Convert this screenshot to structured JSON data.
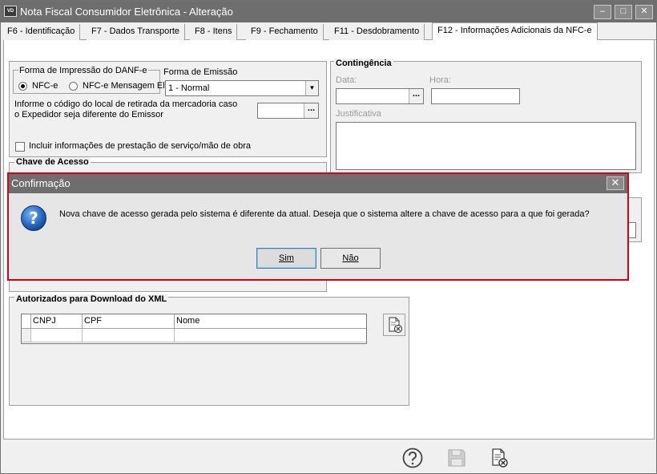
{
  "window": {
    "icon_text": "VD",
    "title": "Nota Fiscal Consumidor Eletrônica - Alteração",
    "minimize": "–",
    "maximize": "□",
    "close": "✕"
  },
  "tabs": [
    {
      "label": "F6 - Identificação"
    },
    {
      "label": "F7 - Dados Transporte"
    },
    {
      "label": "F8 - Itens"
    },
    {
      "label": "F9 - Fechamento"
    },
    {
      "label": "F11 - Desdobramento"
    },
    {
      "label": "F12 - Informações Adicionais da NFC-e"
    }
  ],
  "danfe": {
    "group_label": "Forma de Impressão do DANF-e",
    "option1": "NFC-e",
    "option2": "NFC-e Mensagem El",
    "selected": "NFC-e"
  },
  "emissao": {
    "label": "Forma de Emissão",
    "value": "1 - Normal",
    "arrow": "▼"
  },
  "retirada": {
    "line1": "Informe o código do local de retirada da mercadoria caso",
    "line2": "o Expedidor seja diferente do Emissor",
    "button": "..."
  },
  "servico": {
    "label": "Incluir informações de prestação de serviço/mão de obra",
    "checked": false
  },
  "chave": {
    "title": "Chave de Acesso"
  },
  "contingencia": {
    "title": "Contingência",
    "data_label": "Data:",
    "hora_label": "Hora:",
    "justificativa_label": "Justificativa",
    "button": "..."
  },
  "autorizados": {
    "title": "Autorizados para Download do XML",
    "columns": [
      "CNPJ",
      "CPF",
      "Nome"
    ]
  },
  "dialog": {
    "title": "Confirmação",
    "close": "✕",
    "icon": "?",
    "message": "Nova chave de acesso gerada pelo sistema é diferente da atual. Deseja que o sistema altere a chave de acesso para a que foi gerada?",
    "yes": "Sim",
    "no": "Não"
  },
  "colors": {
    "titlebar": "#6e6e6e",
    "dialog_border": "#d9001c",
    "question_icon": "#1f5fb0"
  }
}
